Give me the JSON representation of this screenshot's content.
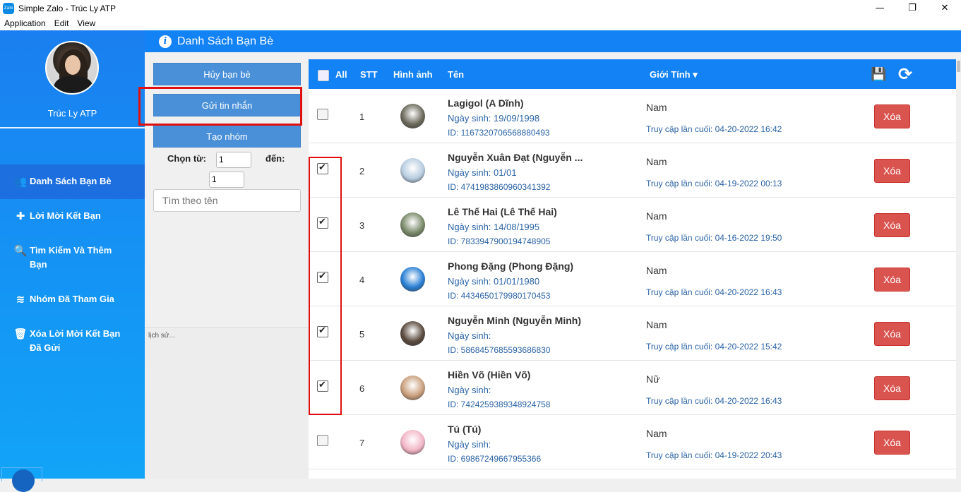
{
  "window": {
    "title": "Simple Zalo - Trúc Ly ATP",
    "app_icon_label": "Zalo",
    "controls": [
      "—",
      "❐",
      "✕"
    ]
  },
  "menu": [
    "Application",
    "Edit",
    "View"
  ],
  "sidebar": {
    "user_name": "Trúc Ly ATP",
    "items": [
      {
        "label": "Danh Sách Bạn Bè",
        "icon": "users-icon",
        "glyph": "👥",
        "active": true
      },
      {
        "label": "Lời Mời Kết Bạn",
        "icon": "plus-icon",
        "glyph": "✚",
        "active": false
      },
      {
        "label": "Tìm Kiếm Và Thêm Bạn",
        "icon": "search-plus-icon",
        "glyph": "🔍",
        "active": false
      },
      {
        "label": "Nhóm Đã Tham Gia",
        "icon": "layers-icon",
        "glyph": "≋",
        "active": false
      },
      {
        "label": "Xóa Lời Mời Kết Bạn Đã Gửi",
        "icon": "trash-icon",
        "glyph": "🗑",
        "active": false
      }
    ]
  },
  "header": {
    "title": "Danh Sách Bạn Bè",
    "icon": "info-icon",
    "glyph": "i"
  },
  "panel": {
    "unfriend_button": "Hủy bạn bè",
    "send_message_button": "Gửi tin nhắn",
    "create_group_button": "Tạo nhóm",
    "from_label": "Chọn từ:",
    "from_value": "1",
    "to_label": "đến:",
    "to_value": "1",
    "search_placeholder": "Tìm theo tên",
    "history_text": "lịch sử..."
  },
  "table": {
    "headers": {
      "all": "All",
      "stt": "STT",
      "image": "Hình ảnh",
      "name": "Tên",
      "gender": "Giới Tính",
      "sort_glyph": "▾"
    },
    "save_glyph": "💾",
    "refresh_glyph": "⟳",
    "rows": [
      {
        "stt": "1",
        "name": "Lagigol (A Dĩnh)",
        "dob": "Ngày sinh: 19/09/1998",
        "id": "ID: 1167320706568880493",
        "gender": "Nam",
        "last": "Truy cập lần cuối: 04-20-2022 16:42",
        "checked": false,
        "delete": "Xóa",
        "avatar_color": "#6b6a5c"
      },
      {
        "stt": "2",
        "name": "Nguyễn Xuân Đạt (Nguyễn ...",
        "dob": "Ngày sinh: 01/01",
        "id": "ID: 4741983860960341392",
        "gender": "Nam",
        "last": "Truy cập lần cuối: 04-19-2022 00:13",
        "checked": true,
        "delete": "Xóa",
        "avatar_color": "#b8cde0"
      },
      {
        "stt": "3",
        "name": "Lê Thế Hai (Lê Thế Hai)",
        "dob": "Ngày sinh: 14/08/1995",
        "id": "ID: 7833947900194748905",
        "gender": "Nam",
        "last": "Truy cập lần cuối: 04-16-2022 19:50",
        "checked": true,
        "delete": "Xóa",
        "avatar_color": "#7a8a6a"
      },
      {
        "stt": "4",
        "name": "Phong Đặng (Phong Đặng)",
        "dob": "Ngày sinh: 01/01/1980",
        "id": "ID: 4434650179980170453",
        "gender": "Nam",
        "last": "Truy cập lần cuối: 04-20-2022 16:43",
        "checked": true,
        "delete": "Xóa",
        "avatar_color": "#2a7fd4"
      },
      {
        "stt": "5",
        "name": "Nguyễn Minh (Nguyễn Minh)",
        "dob": "Ngày sinh:",
        "id": "ID: 5868457685593686830",
        "gender": "Nam",
        "last": "Truy cập lần cuối: 04-20-2022 15:42",
        "checked": true,
        "delete": "Xóa",
        "avatar_color": "#5a4a3e"
      },
      {
        "stt": "6",
        "name": "Hiền Võ (Hiền Võ)",
        "dob": "Ngày sinh:",
        "id": "ID: 7424259389348924758",
        "gender": "Nữ",
        "last": "Truy cập lần cuối: 04-20-2022 16:43",
        "checked": true,
        "delete": "Xóa",
        "avatar_color": "#caa07e"
      },
      {
        "stt": "7",
        "name": "Tú (Tú)",
        "dob": "Ngày sinh:",
        "id": "ID: 69867249667955366",
        "gender": "Nam",
        "last": "Truy cập lần cuối: 04-19-2022 20:43",
        "checked": false,
        "delete": "Xóa",
        "avatar_color": "#f2b6c6"
      }
    ]
  }
}
